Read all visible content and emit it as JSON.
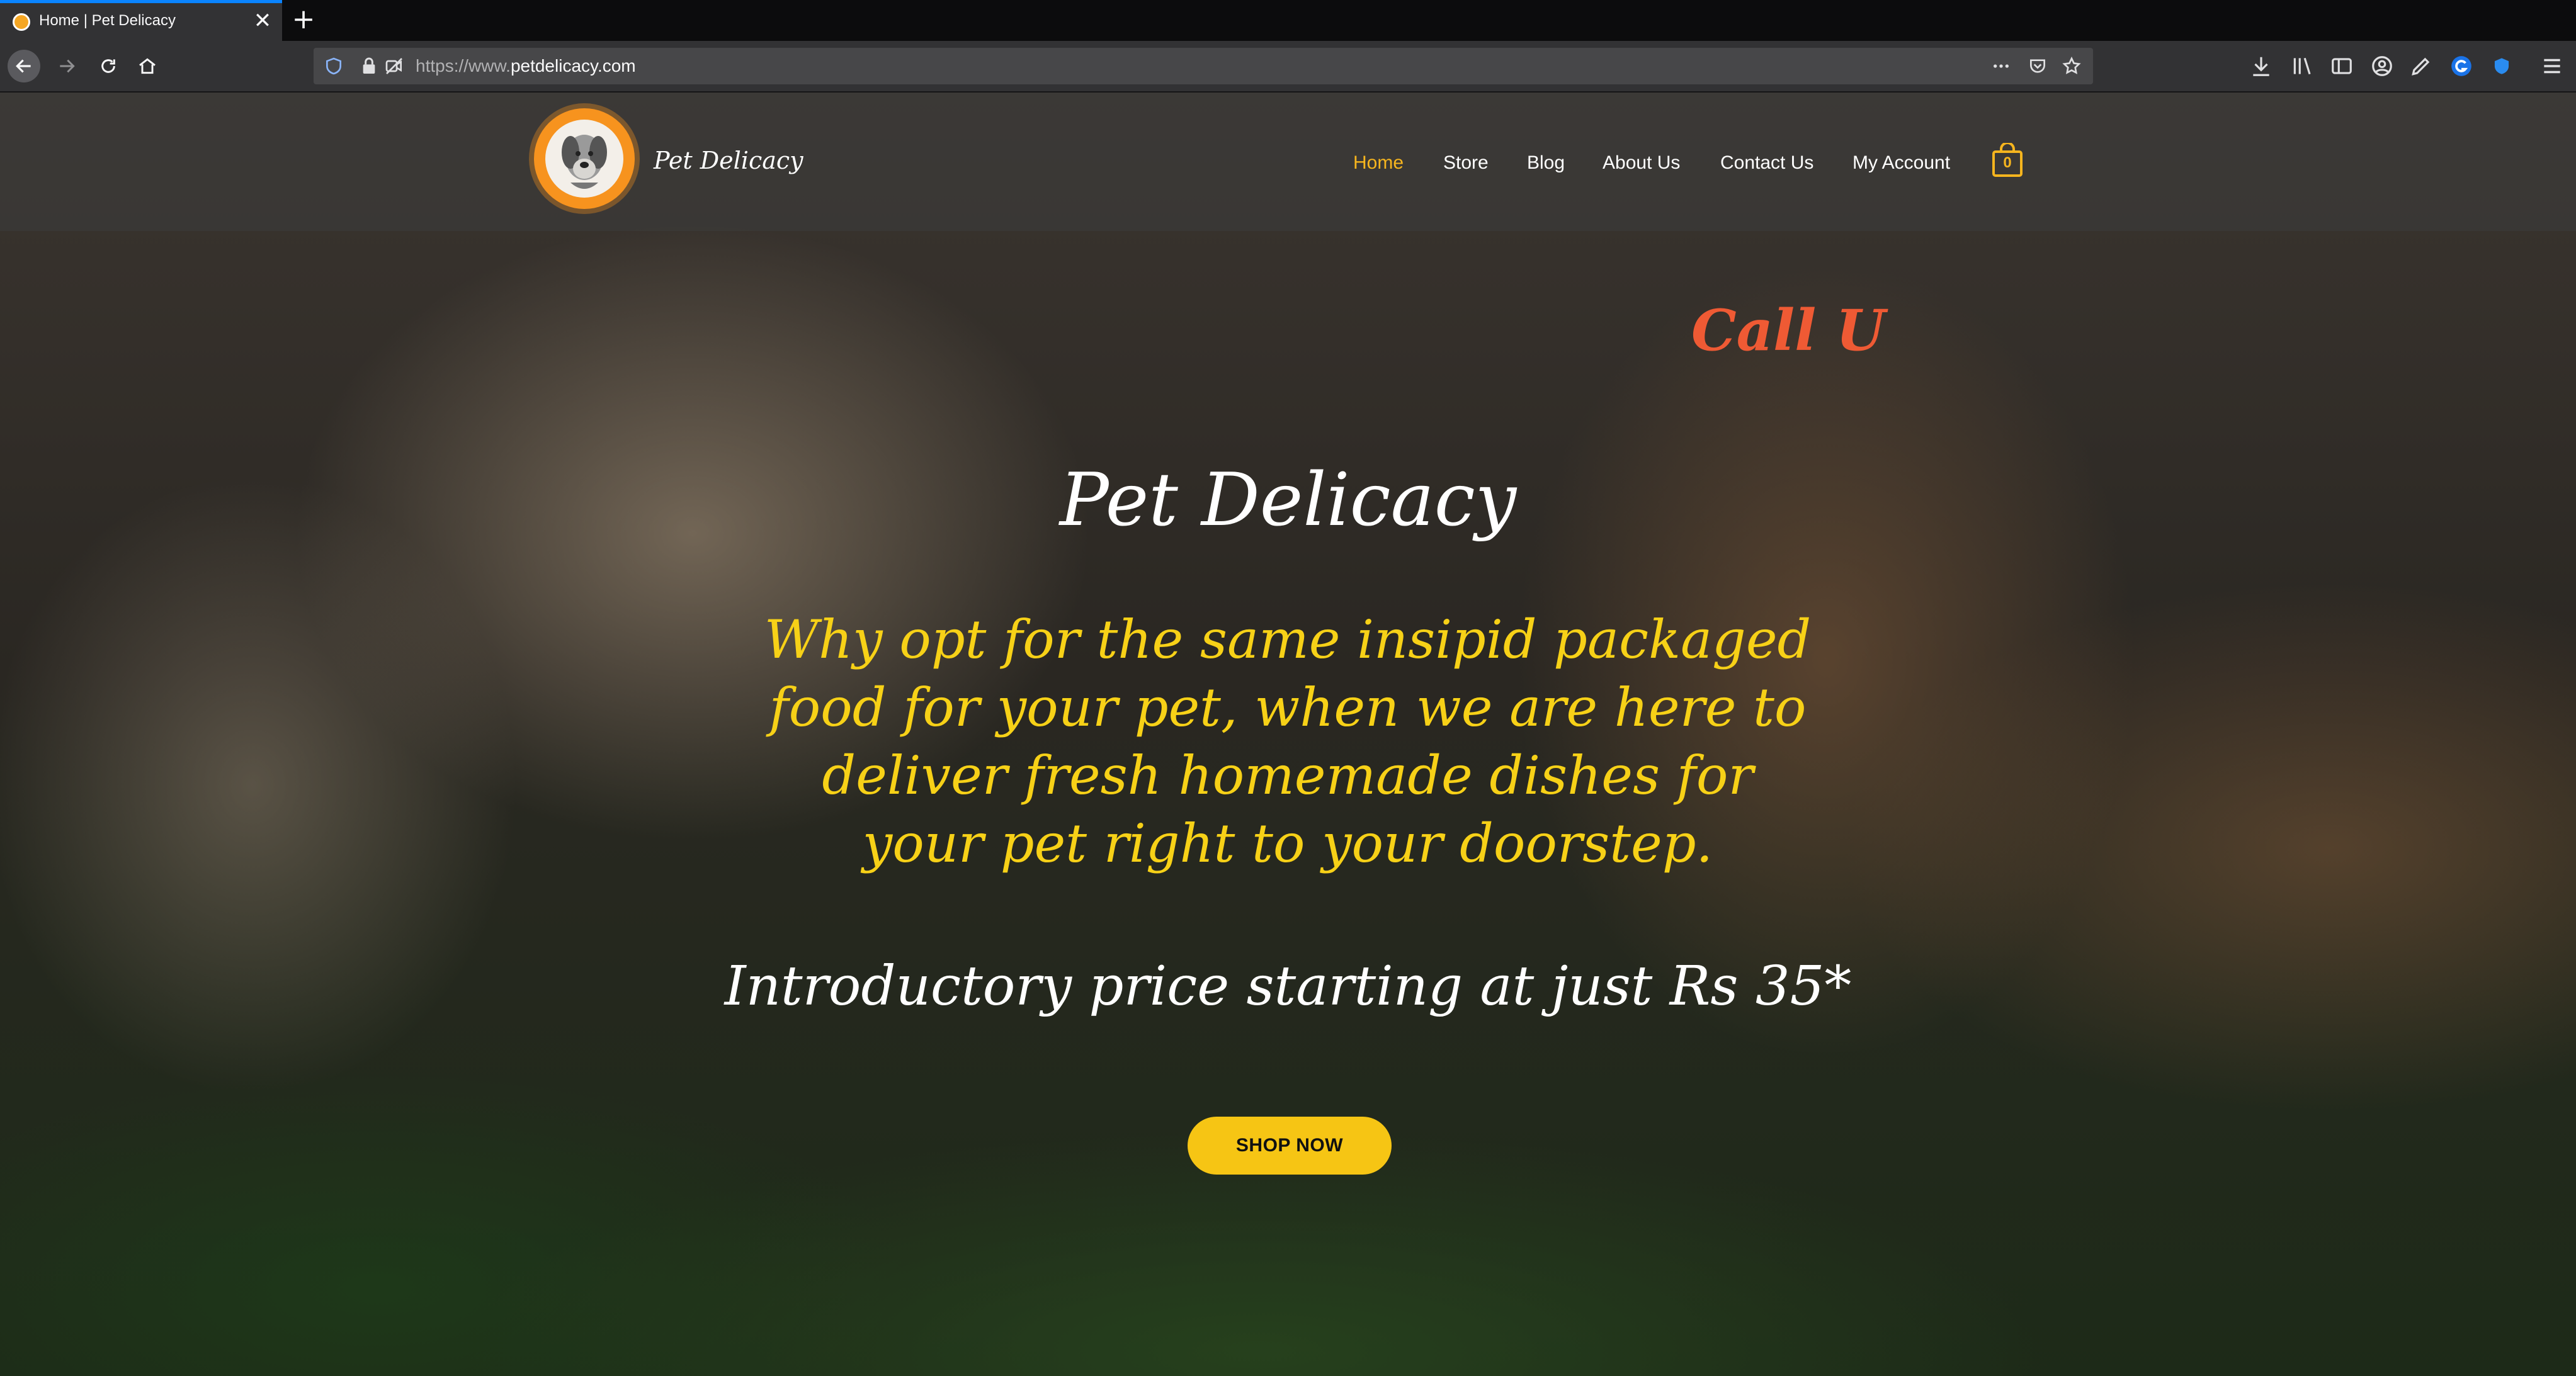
{
  "browser": {
    "tab_title": "Home | Pet Delicacy",
    "close_symbol": "✕",
    "new_tab_symbol": "+",
    "url_prefix": "https://www.",
    "url_domain": "petdelicacy.com"
  },
  "site": {
    "brand": "Pet Delicacy",
    "nav": [
      "Home",
      "Store",
      "Blog",
      "About Us",
      "Contact Us",
      "My Account"
    ],
    "active_nav": "Home",
    "cart_count": "0"
  },
  "hero": {
    "call_text": "Call U",
    "title": "Pet Delicacy",
    "description": "Why opt for the same insipid packaged food for your pet, when we are here to deliver fresh homemade dishes for your pet right to your doorstep.",
    "price_text": "Introductory price starting at just Rs 35*",
    "cta": "SHOP NOW"
  },
  "colors": {
    "accent_gold": "#f6b51e",
    "headline_yellow": "#f7d117",
    "call_orange": "#ef5a34",
    "button_yellow": "#f6c514"
  },
  "icons": [
    "back-arrow-icon",
    "forward-arrow-icon",
    "reload-icon",
    "home-icon",
    "shield-icon",
    "lock-icon",
    "permissions-icon",
    "more-icon",
    "pocket-icon",
    "bookmark-star-icon",
    "download-icon",
    "library-icon",
    "sidebar-icon",
    "account-icon",
    "pen-icon",
    "extension-icon",
    "menu-icon",
    "cart-icon"
  ]
}
